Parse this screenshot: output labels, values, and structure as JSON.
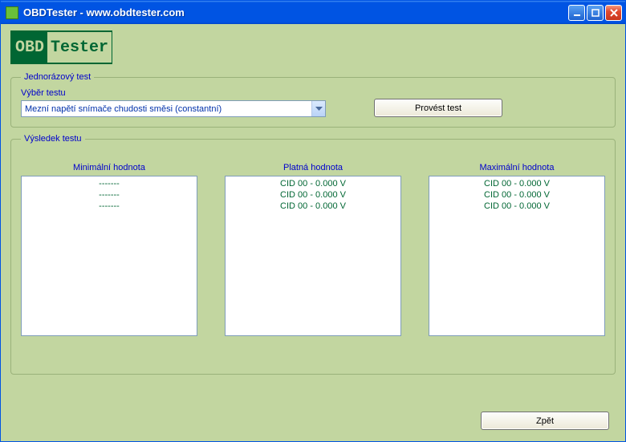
{
  "window": {
    "title": "OBDTester - www.obdtester.com"
  },
  "logo": {
    "left": "OBD",
    "right": "Tester"
  },
  "onetime": {
    "legend": "Jednorázový test",
    "select_label": "Výběr testu",
    "selected": "Mezní napětí snímače chudosti směsi (constantní)",
    "run_button": "Provést test"
  },
  "results": {
    "legend": "Výsledek testu",
    "columns": {
      "min": {
        "header": "Minimální hodnota",
        "items": [
          "-------",
          "-------",
          "-------"
        ]
      },
      "valid": {
        "header": "Platná hodnota",
        "items": [
          "CID 00 - 0.000 V",
          "CID 00 - 0.000 V",
          "CID 00 - 0.000 V"
        ]
      },
      "max": {
        "header": "Maximální hodnota",
        "items": [
          "CID 00 - 0.000 V",
          "CID 00 - 0.000 V",
          "CID 00 - 0.000 V"
        ]
      }
    }
  },
  "footer": {
    "back": "Zpět"
  }
}
